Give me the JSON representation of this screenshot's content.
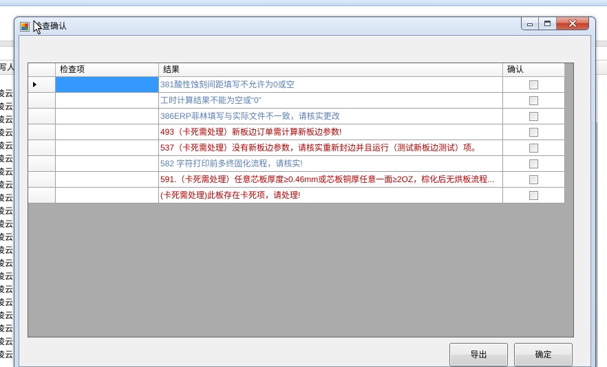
{
  "background_app": {
    "left_header": "写人",
    "left_rows": [
      "凌云",
      "凌云",
      "凌云",
      "凌云",
      "凌云",
      "凌云",
      "凌云",
      "凌云",
      "凌云",
      "凌云",
      "凌云",
      "凌云",
      "凌云",
      "凌云",
      "凌云",
      "凌云",
      "凌云",
      "凌云",
      "凌云",
      "凌云",
      "凌云"
    ]
  },
  "dialog": {
    "title": "检查确认",
    "grid": {
      "columns": {
        "item": "检查项",
        "result": "结果",
        "confirm": "确认"
      },
      "rows": [
        {
          "result": "381酸性蚀刻间距填写不允许为0或空",
          "confirmed": false,
          "color": "#5a80ba"
        },
        {
          "result": "工时计算结果不能为空或“0”",
          "confirmed": false,
          "color": "#5a80ba"
        },
        {
          "result": "386ERP菲林填写与实际文件不一致，请核实更改",
          "confirmed": false,
          "color": "#5a80ba"
        },
        {
          "result": "493（卡死需处理）新板边订单需计算新板边参数!",
          "confirmed": false,
          "color": "#b80000"
        },
        {
          "result": "537（卡死需处理）没有新板边参数，请核实重新封边并且运行（测试新板边测试）项。",
          "confirmed": false,
          "color": "#b80000"
        },
        {
          "result": "582 字符打印前多终固化流程，请核实!",
          "confirmed": false,
          "color": "#5a80ba"
        },
        {
          "result": "591.（卡死需处理）任意芯板厚度≥0.46mm或芯板铜厚任意一面≥2OZ，棕化后无烘板流程...",
          "confirmed": false,
          "color": "#b80000"
        },
        {
          "result": "(卡死需处理)此板存在卡死项，请处理!",
          "confirmed": false,
          "color": "#b80000"
        }
      ]
    },
    "buttons": {
      "export": "导出",
      "ok": "确定"
    }
  },
  "icons": {
    "title": "app-window-icon",
    "cursor": "mouse-cursor-icon",
    "minimize": "minimize-icon",
    "maximize": "maximize-icon",
    "close": "close-icon",
    "row_indicator": "current-row-indicator-icon"
  },
  "colors": {
    "selection": "#3399ff",
    "info_text": "#5a80ba",
    "blocking_text": "#b80000",
    "grid_background": "#ababab",
    "close_button": "#c6402a"
  }
}
